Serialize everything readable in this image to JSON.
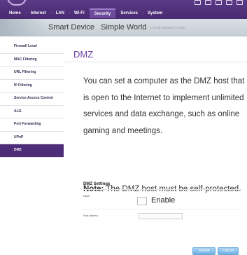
{
  "nav": {
    "items": [
      "Home",
      "Internet",
      "LAN",
      "Wi-Fi",
      "Security",
      "Services",
      "System"
    ],
    "active_index": 4
  },
  "banner": {
    "tagline_main": "Smart Device   Simple World",
    "tagline_sub": "LTE Broadband Center"
  },
  "sidebar": {
    "items": [
      "Firewall Level",
      "MAC Filtering",
      "URL Filtering",
      "IP Filtering",
      "Service Access Control",
      "ALG",
      "Port Forwarding",
      "UPnP",
      "DMZ"
    ],
    "active_index": 8
  },
  "main": {
    "title": "DMZ",
    "description": "You can set a computer as the DMZ host that is open to the Internet to implement unlimited services and data exchange, such as online gaming and meetings.",
    "note_label": "Note:",
    "note_text": " The DMZ host must be self-protected.",
    "settings_title": "DMZ Settings",
    "dmz_label": "DMZ:",
    "enable_label": "Enable",
    "enable_checked": false,
    "host_label": "Host address:",
    "host_value": "",
    "submit_label": "Submit",
    "cancel_label": "Cancel"
  },
  "colors": {
    "brand_purple": "#4e2d78",
    "title_purple": "#6a3fa0",
    "button_blue": "#6fb0e2"
  }
}
